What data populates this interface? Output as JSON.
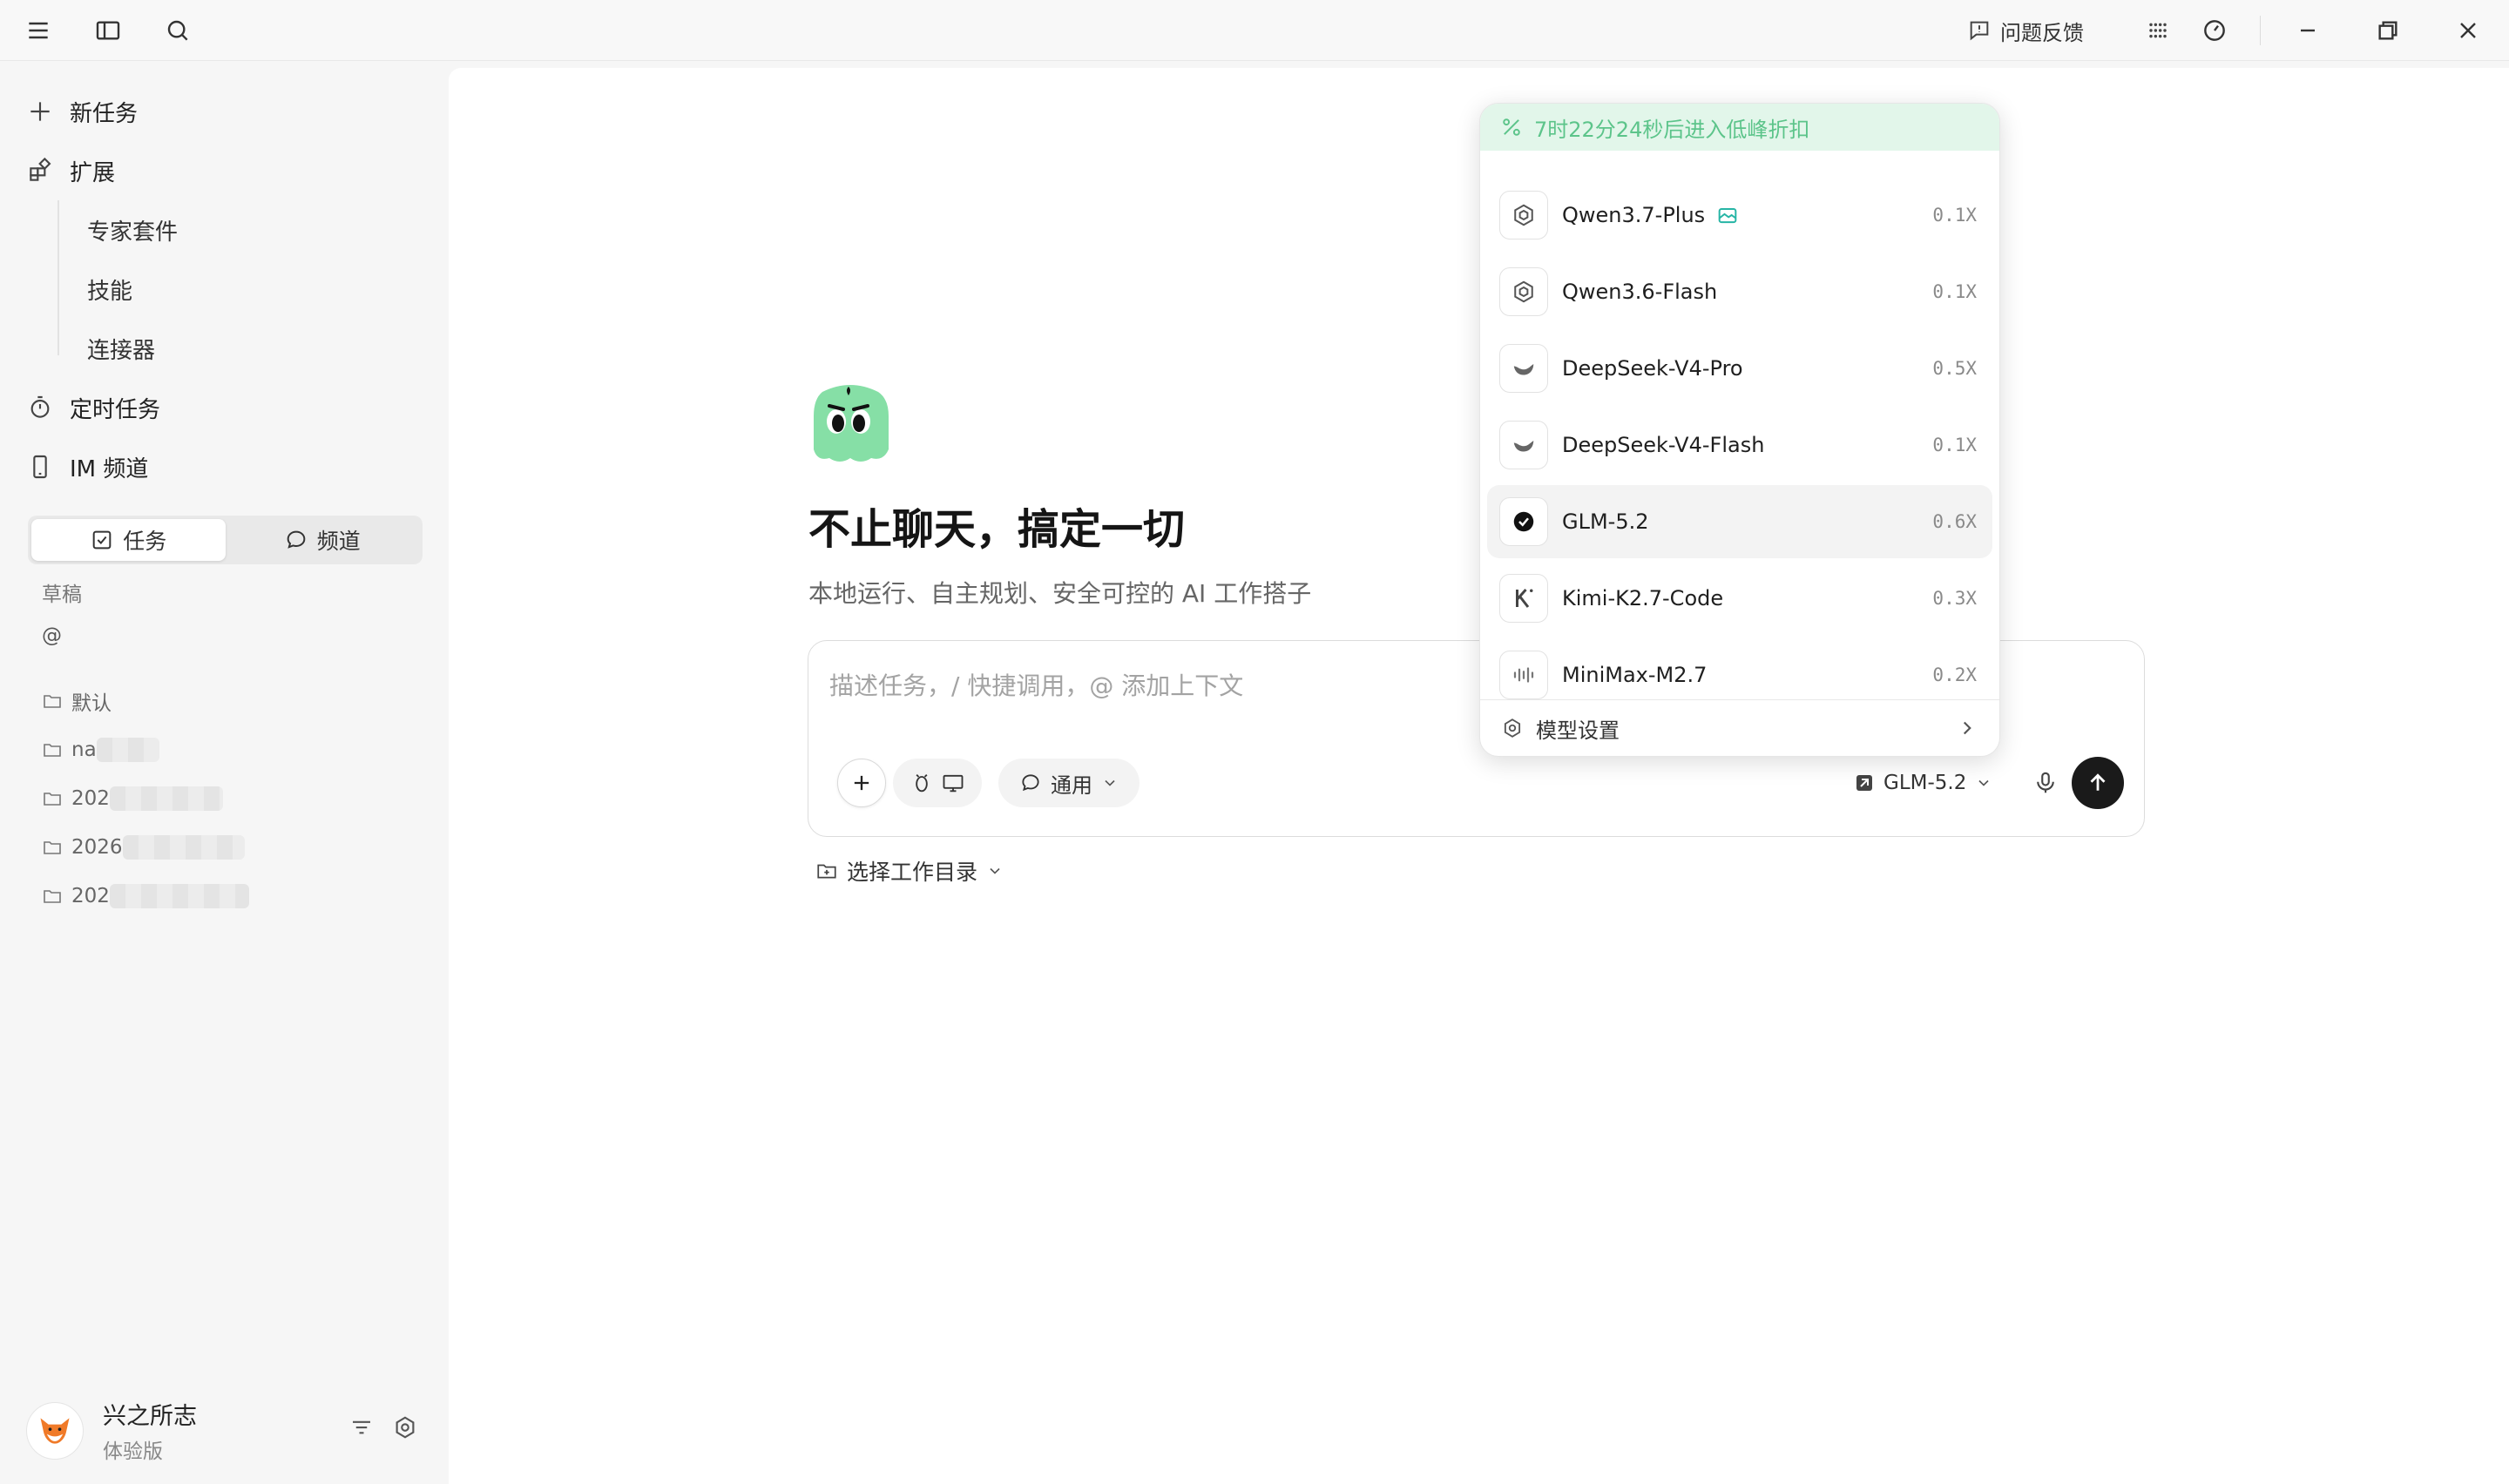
{
  "titlebar": {
    "feedback_label": "问题反馈"
  },
  "sidebar": {
    "nav": {
      "new_task": "新任务",
      "extensions": "扩展",
      "sub_items": [
        "专家套件",
        "技能",
        "连接器"
      ],
      "scheduled": "定时任务",
      "im_channel": "IM 频道"
    },
    "tabs": {
      "tasks": "任务",
      "channels": "频道"
    },
    "drafts_label": "草稿",
    "at_label": "@",
    "folders": [
      "默认",
      "na",
      "202",
      "2026",
      "202"
    ],
    "user": {
      "name": "兴之所志",
      "plan": "体验版"
    }
  },
  "main": {
    "headline": "不止聊天，搞定一切",
    "subline": "本地运行、自主规划、安全可控的 AI 工作搭子",
    "composer": {
      "placeholder": "描述任务，/ 快捷调用，@ 添加上下文",
      "mode_label": "通用",
      "model_label": "GLM-5.2"
    },
    "workdir_label": "选择工作目录"
  },
  "model_dropdown": {
    "banner": "7时22分24秒后进入低峰折扣",
    "models": [
      {
        "name": "Qwen3.7-Plus",
        "multiplier": "0.1X",
        "icon": "qwen-icon",
        "badge": "vision-badge-icon"
      },
      {
        "name": "Qwen3.6-Flash",
        "multiplier": "0.1X",
        "icon": "qwen-icon"
      },
      {
        "name": "DeepSeek-V4-Pro",
        "multiplier": "0.5X",
        "icon": "deepseek-icon"
      },
      {
        "name": "DeepSeek-V4-Flash",
        "multiplier": "0.1X",
        "icon": "deepseek-icon"
      },
      {
        "name": "GLM-5.2",
        "multiplier": "0.6X",
        "icon": "glm-icon",
        "selected": true
      },
      {
        "name": "Kimi-K2.7-Code",
        "multiplier": "0.3X",
        "icon": "kimi-icon"
      },
      {
        "name": "MiniMax-M2.7",
        "multiplier": "0.2X",
        "icon": "minimax-icon"
      }
    ],
    "settings_label": "模型设置"
  },
  "colors": {
    "accent_green": "#5cc48a",
    "banner_bg": "#e2f6ea",
    "send_button": "#1a1a1a"
  }
}
